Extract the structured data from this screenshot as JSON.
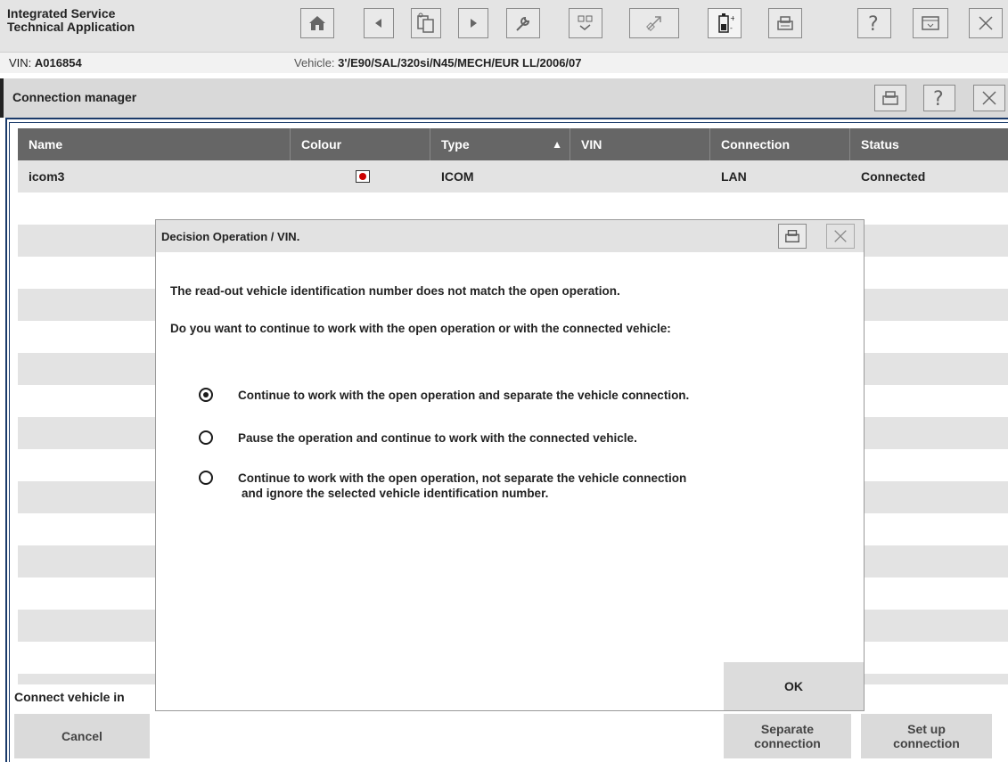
{
  "app": {
    "title_line1": "Integrated Service",
    "title_line2": "Technical Application"
  },
  "toolbar": {
    "buttons": [
      "home-icon",
      "back-arrow-icon",
      "clipboard-icon",
      "forward-arrow-icon",
      "wrench-icon",
      "vehicle-tester-icon",
      "cable-icon",
      "battery-icon",
      "print-icon",
      "help-icon",
      "minimize-icon",
      "close-icon"
    ]
  },
  "vinbar": {
    "vin_label": "VIN:",
    "vin_value": "A016854",
    "vehicle_label": "Vehicle:",
    "vehicle_value": "3'/E90/SAL/320si/N45/MECH/EUR LL/2006/07"
  },
  "connection_manager": {
    "title": "Connection manager",
    "columns": [
      "Name",
      "Colour",
      "Type",
      "VIN",
      "Connection",
      "Status"
    ],
    "sort_indicator": "▲",
    "rows": [
      {
        "name": "icom3",
        "colour": "#cc0000",
        "type": "ICOM",
        "vin": "",
        "connection": "LAN",
        "status": "Connected"
      }
    ],
    "connect_info": "Connect vehicle in",
    "buttons": {
      "cancel": "Cancel",
      "separate_line1": "Separate",
      "separate_line2": "connection",
      "setup_line1": "Set up",
      "setup_line2": "connection"
    }
  },
  "dialog": {
    "title": "Decision Operation / VIN.",
    "message1": "The read-out vehicle identification number does not match the open operation.",
    "message2": "Do you want to continue to work with the open operation or with the connected vehicle:",
    "options": [
      {
        "line1": "Continue to work with the open operation and separate the vehicle connection.",
        "line2": "",
        "checked": true
      },
      {
        "line1": "Pause the operation and continue to work with the connected vehicle.",
        "line2": "",
        "checked": false
      },
      {
        "line1": "Continue to work with the open operation, not separate the vehicle connection",
        "line2": "and ignore the selected vehicle identification number.",
        "checked": false
      }
    ],
    "ok": "OK"
  }
}
